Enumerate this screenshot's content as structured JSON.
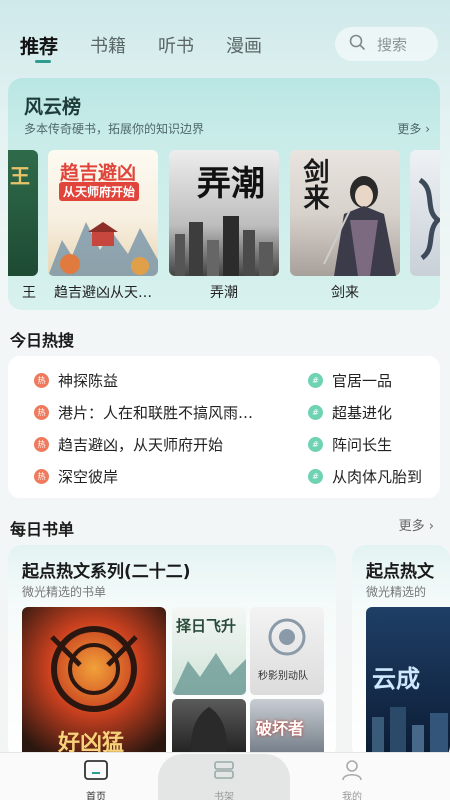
{
  "tabs": [
    {
      "label": "推荐",
      "active": true
    },
    {
      "label": "书籍",
      "active": false
    },
    {
      "label": "听书",
      "active": false
    },
    {
      "label": "漫画",
      "active": false
    }
  ],
  "search": {
    "label": "搜索",
    "icon": "search-icon"
  },
  "ranking": {
    "title": "风云榜",
    "subtitle": "多本传奇硬书，拓展你的知识边界",
    "more": "更多",
    "books": [
      {
        "title": "王",
        "cover_text": "王"
      },
      {
        "title": "趋吉避凶从天…",
        "cover_text": "趋吉避凶",
        "cover_subtext": "从天师府开始"
      },
      {
        "title": "弄潮",
        "cover_text": "弄潮"
      },
      {
        "title": "剑来",
        "cover_text": "剑来"
      }
    ]
  },
  "hot_search": {
    "title": "今日热搜",
    "badge_hot": "热",
    "badge_new": "#",
    "left": [
      "神探陈益",
      "港片：人在和联胜不搞风雨…",
      "趋吉避凶，从天师府开始",
      "深空彼岸"
    ],
    "right": [
      "官居一品",
      "超基进化",
      "阵问长生",
      "从肉体凡胎到"
    ]
  },
  "daily_list": {
    "title": "每日书单",
    "more": "更多",
    "cards": [
      {
        "title": "起点热文系列(二十二)",
        "subtitle": "微光精选的书单",
        "covers": [
          "好凶猛",
          "择日飞升",
          "秒影别动队",
          "",
          "破坏者"
        ]
      },
      {
        "title": "起点热文",
        "subtitle": "微光精选的",
        "covers": [
          "云成"
        ]
      }
    ]
  },
  "bottom_nav": [
    {
      "label": "首页",
      "icon": "home-icon",
      "active": true
    },
    {
      "label": "书架",
      "icon": "bookshelf-icon",
      "active": false
    },
    {
      "label": "我的",
      "icon": "profile-icon",
      "active": false
    }
  ],
  "colors": {
    "accent": "#2e9c8f",
    "hot_badge": "#f07a5e",
    "new_badge": "#6fd3b3"
  }
}
